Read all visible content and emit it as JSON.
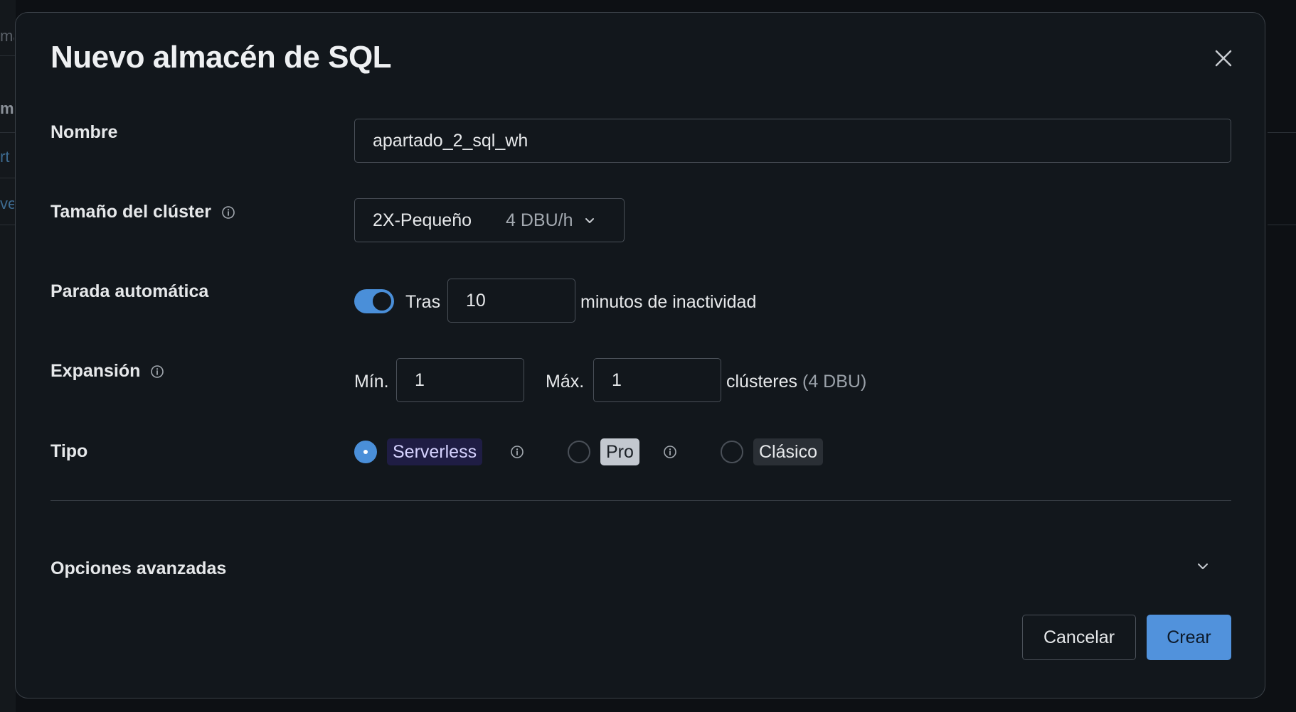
{
  "background": {
    "fragments": [
      "ma",
      "m",
      "rt",
      "ve"
    ]
  },
  "modal": {
    "title": "Nuevo almacén de SQL",
    "close_icon": "close-icon"
  },
  "fields": {
    "name": {
      "label": "Nombre",
      "value": "apartado_2_sql_wh"
    },
    "cluster_size": {
      "label": "Tamaño del clúster",
      "value": "2X-Pequeño",
      "extra": "4 DBU/h"
    },
    "auto_stop": {
      "label": "Parada automática",
      "enabled": true,
      "prefix": "Tras",
      "value": "10",
      "suffix": "minutos de inactividad"
    },
    "scaling": {
      "label": "Expansión",
      "min_label": "Mín.",
      "min_value": "1",
      "max_label": "Máx.",
      "max_value": "1",
      "suffix": "clústeres",
      "extra": "(4 DBU)"
    },
    "type": {
      "label": "Tipo",
      "selected": "Serverless",
      "options": [
        "Serverless",
        "Pro",
        "Clásico"
      ]
    }
  },
  "advanced": {
    "label": "Opciones avanzadas"
  },
  "buttons": {
    "cancel": "Cancelar",
    "create": "Crear"
  },
  "colors": {
    "accent": "#4a8fd9",
    "primary_button": "#5192dc",
    "background": "#12171c"
  }
}
